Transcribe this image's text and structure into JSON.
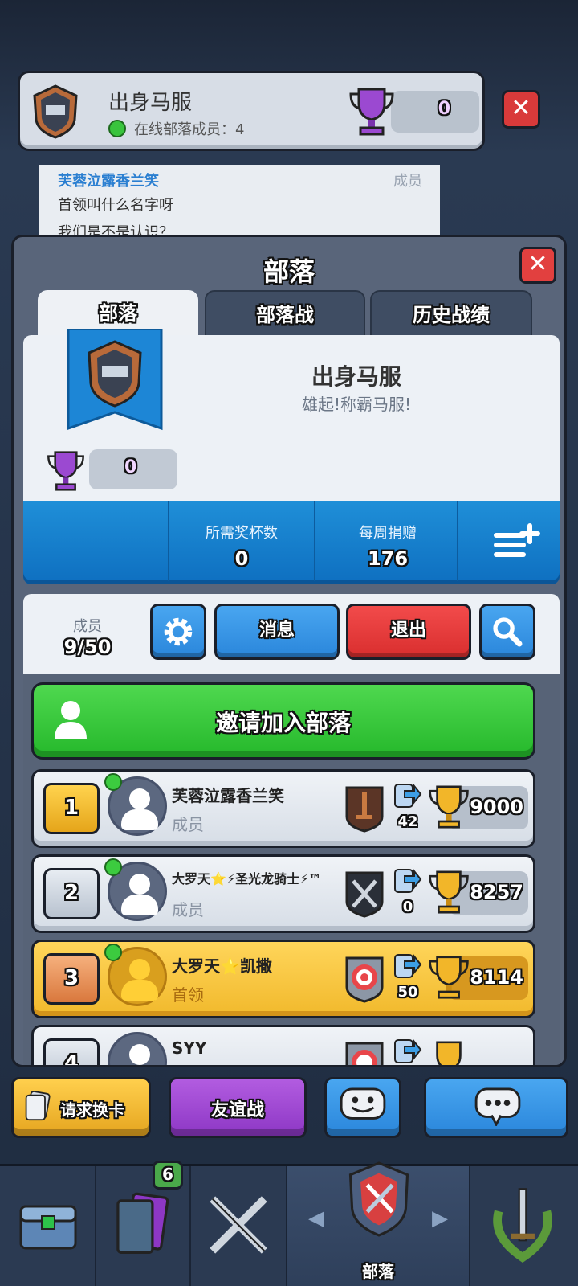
{
  "header": {
    "clan_name": "出身马服",
    "online_text": "在线部落成员：4",
    "trophies": "0"
  },
  "chat": {
    "sender": "芙蓉泣露香兰笑",
    "role": "成员",
    "message_1": "首领叫什么名字呀",
    "message_2": "我们是不是认识？"
  },
  "panel": {
    "title": "部落",
    "tabs": [
      {
        "label": "部落",
        "active": true
      },
      {
        "label": "部落战",
        "active": false
      },
      {
        "label": "历史战绩",
        "active": false
      }
    ]
  },
  "clan": {
    "name": "出身马服",
    "description": "雄起!称霸马服!",
    "trophies": "0",
    "required_trophies_label": "所需奖杯数",
    "required_trophies": "0",
    "weekly_donations_label": "每周捐赠",
    "weekly_donations": "176"
  },
  "members": {
    "label": "成员",
    "count": "9/50",
    "message_button": "消息",
    "leave_button": "退出",
    "invite_button": "邀请加入部落",
    "list": [
      {
        "rank": "1",
        "name": "芙蓉泣露香兰笑",
        "role": "成员",
        "donations": "42",
        "trophies": "9000",
        "online": true
      },
      {
        "rank": "2",
        "name": "大罗天⭐⚡圣光龙骑士⚡™",
        "role": "成员",
        "donations": "0",
        "trophies": "8257",
        "online": true
      },
      {
        "rank": "3",
        "name": "大罗天⭐凯撒",
        "role": "首领",
        "donations": "50",
        "trophies": "8114",
        "online": true
      },
      {
        "rank": "4",
        "name": "SYY",
        "role": "",
        "donations": "",
        "trophies": "",
        "online": false
      }
    ]
  },
  "actions": {
    "request_cards": "请求换卡",
    "friendly_battle": "友谊战"
  },
  "nav": {
    "cards_badge": "6",
    "clan_label": "部落"
  },
  "colors": {
    "green": "#25b82b",
    "blue": "#2a86db",
    "red": "#d92e2e",
    "gold": "#f1b92c",
    "purple": "#8d37c5"
  }
}
